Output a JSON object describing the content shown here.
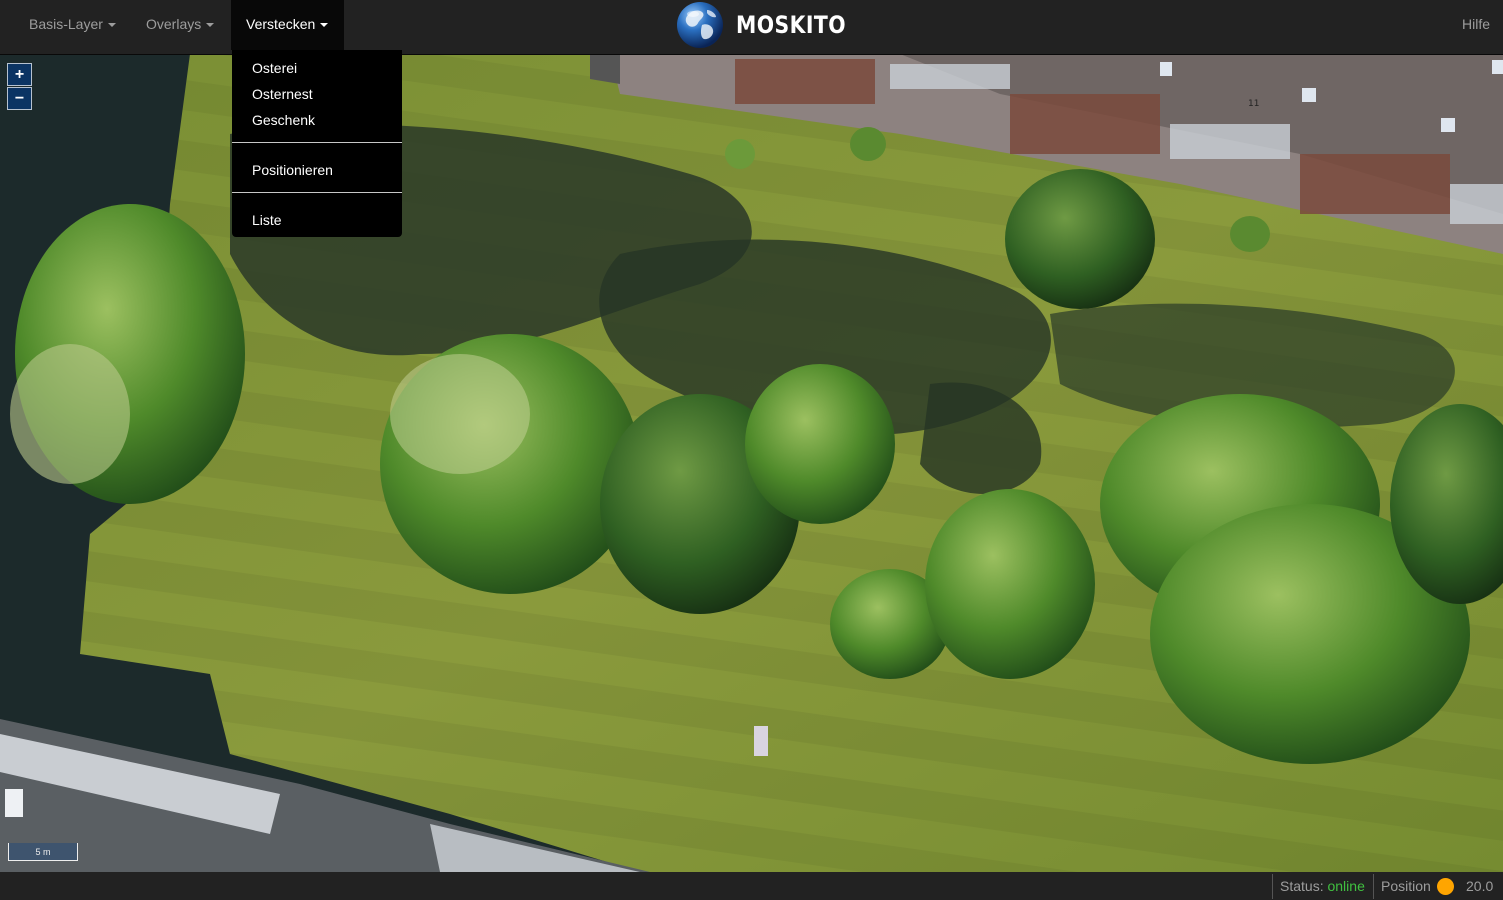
{
  "navbar": {
    "menus": [
      {
        "label": "Basis-Layer"
      },
      {
        "label": "Overlays"
      },
      {
        "label": "Verstecken"
      }
    ],
    "brand": "MOSKITO",
    "help_label": "Hilfe"
  },
  "dropdown": {
    "items": [
      "Osterei",
      "Osternest",
      "Geschenk",
      "Positionieren",
      "Liste"
    ]
  },
  "map": {
    "zoom_in": "+",
    "zoom_out": "−",
    "scale_label": "5 m",
    "house_number": "11"
  },
  "statusbar": {
    "status_label": "Status:",
    "status_value": "online",
    "position_label": "Position",
    "position_value": "20.0",
    "position_indicator_color": "#ffa500"
  }
}
